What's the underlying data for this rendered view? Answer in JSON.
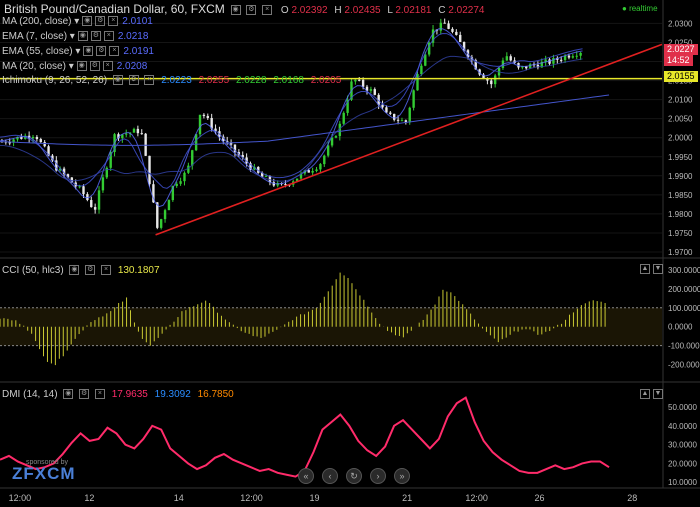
{
  "header": {
    "title": "British Pound/Canadian Dollar, 60, FXCM",
    "o_label": "O",
    "o": "2.02392",
    "h_label": "H",
    "h": "2.02435",
    "l_label": "L",
    "l": "2.02181",
    "c_label": "C",
    "c": "2.02274",
    "realtime": "realtime"
  },
  "indicators": [
    {
      "label": "MA (200, close)",
      "value": "2.0101",
      "color": "#5a6cff"
    },
    {
      "label": "EMA (7, close)",
      "value": "2.0218",
      "color": "#5a6cff"
    },
    {
      "label": "EMA (55, close)",
      "value": "2.0191",
      "color": "#5a6cff"
    },
    {
      "label": "MA (20, close)",
      "value": "2.0208",
      "color": "#5a6cff"
    }
  ],
  "ichimoku": {
    "label": "Ichimoku (9, 26, 52, 26)",
    "v1": "2.0223",
    "c1": "#2a8cff",
    "v2": "2.0255",
    "c2": "#e0304a",
    "v3": "2.0228",
    "c3": "#33cc33",
    "v4": "2.0168",
    "c4": "#33cc33",
    "v5": "2.0205",
    "c5": "#e0304a"
  },
  "price_tags": {
    "last": "2.0227",
    "countdown": "14:52",
    "hline": "2.0155"
  },
  "cci": {
    "label": "CCI (50, hlc3)",
    "value": "130.1807",
    "value_color": "#e8e84a"
  },
  "dmi": {
    "label": "DMI (14, 14)",
    "v1": "17.9635",
    "c1": "#ff2b6a",
    "v2": "19.3092",
    "c2": "#2a8cff",
    "v3": "16.7850",
    "c3": "#ff8a00"
  },
  "watermark": {
    "sponsored": "sponsored by",
    "brand": "FXCM"
  },
  "nav": [
    "«",
    "‹",
    "↻",
    "›",
    "»"
  ],
  "chart_data": [
    {
      "type": "candlestick",
      "panel": "price",
      "series": [
        {
          "name": "GBP/CAD",
          "x_labels": [
            "12:00",
            "12",
            "14",
            "12:00",
            "19",
            "21",
            "12:00",
            "26",
            "28"
          ],
          "values": [
            [
              0,
              1.999
            ],
            [
              0.05,
              2.001
            ],
            [
              0.08,
              1.9925
            ],
            [
              0.12,
              1.986
            ],
            [
              0.14,
              1.981
            ],
            [
              0.17,
              2.0005
            ],
            [
              0.21,
              2.002
            ],
            [
              0.235,
              1.976
            ],
            [
              0.26,
              1.988
            ],
            [
              0.28,
              1.991
            ],
            [
              0.3,
              2.007
            ],
            [
              0.33,
              2.0
            ],
            [
              0.36,
              1.995
            ],
            [
              0.39,
              1.99
            ],
            [
              0.42,
              1.987
            ],
            [
              0.45,
              1.99
            ],
            [
              0.48,
              1.993
            ],
            [
              0.51,
              2.003
            ],
            [
              0.53,
              2.0155
            ],
            [
              0.56,
              2.012
            ],
            [
              0.58,
              2.006
            ],
            [
              0.61,
              2.004
            ],
            [
              0.63,
              2.018
            ],
            [
              0.65,
              2.028
            ],
            [
              0.67,
              2.03
            ],
            [
              0.7,
              2.023
            ],
            [
              0.72,
              2.0175
            ],
            [
              0.74,
              2.014
            ],
            [
              0.76,
              2.022
            ],
            [
              0.78,
              2.018
            ],
            [
              0.8,
              2.019
            ],
            [
              0.83,
              2.02
            ],
            [
              0.86,
              2.022
            ],
            [
              0.88,
              2.023
            ]
          ]
        }
      ],
      "hline": 2.0155,
      "trendline": [
        [
          0.235,
          1.9745
        ],
        [
          1.0,
          2.0245
        ]
      ],
      "y_ticks": [
        "2.0300",
        "2.0250",
        "2.0200",
        "2.0150",
        "2.0100",
        "2.0050",
        "2.0000",
        "1.9950",
        "1.9900",
        "1.9850",
        "1.9800",
        "1.9750",
        "1.9700"
      ],
      "ylim": [
        1.97,
        2.033
      ]
    },
    {
      "type": "bar",
      "panel": "cci",
      "values": [
        45,
        40,
        30,
        10,
        -40,
        -120,
        -180,
        -200,
        -150,
        -90,
        -40,
        10,
        40,
        60,
        80,
        120,
        150,
        20,
        -60,
        -100,
        -60,
        -20,
        30,
        80,
        100,
        120,
        140,
        100,
        60,
        20,
        -10,
        -30,
        -50,
        -60,
        -40,
        -20,
        10,
        40,
        60,
        80,
        100,
        160,
        220,
        290,
        260,
        200,
        140,
        80,
        20,
        -20,
        -40,
        -60,
        -20,
        20,
        60,
        120,
        200,
        180,
        140,
        90,
        40,
        -10,
        -50,
        -80,
        -60,
        -30,
        -10,
        -20,
        -40,
        -30,
        -10,
        20,
        60,
        100,
        120,
        140,
        130
      ],
      "y_ticks": [
        "300.0000",
        "200.0000",
        "100.0000",
        "0.0000",
        "-100.0000",
        "-200.0000"
      ],
      "ylim": [
        -260,
        310
      ]
    },
    {
      "type": "line",
      "panel": "dmi",
      "series": [
        {
          "name": "DMI",
          "values": [
            22,
            24,
            21,
            19,
            17,
            18,
            20,
            25,
            31,
            36,
            32,
            33,
            39,
            36,
            30,
            28,
            33,
            40,
            38,
            28,
            24,
            20,
            17,
            19,
            23,
            25,
            22,
            20,
            18,
            16,
            17,
            15,
            14,
            13,
            16,
            26,
            38,
            42,
            46,
            40,
            32,
            27,
            24,
            29,
            40,
            43,
            38,
            33,
            28,
            33,
            45,
            52,
            55,
            42,
            32,
            26,
            22,
            19,
            16,
            15,
            15,
            17,
            19,
            17,
            18,
            20,
            21,
            21,
            18
          ],
          "color": "#ff2b6a"
        }
      ],
      "y_ticks": [
        "50.0000",
        "40.0000",
        "30.0000",
        "20.0000",
        "10.0000"
      ],
      "ylim": [
        8,
        58
      ]
    }
  ]
}
